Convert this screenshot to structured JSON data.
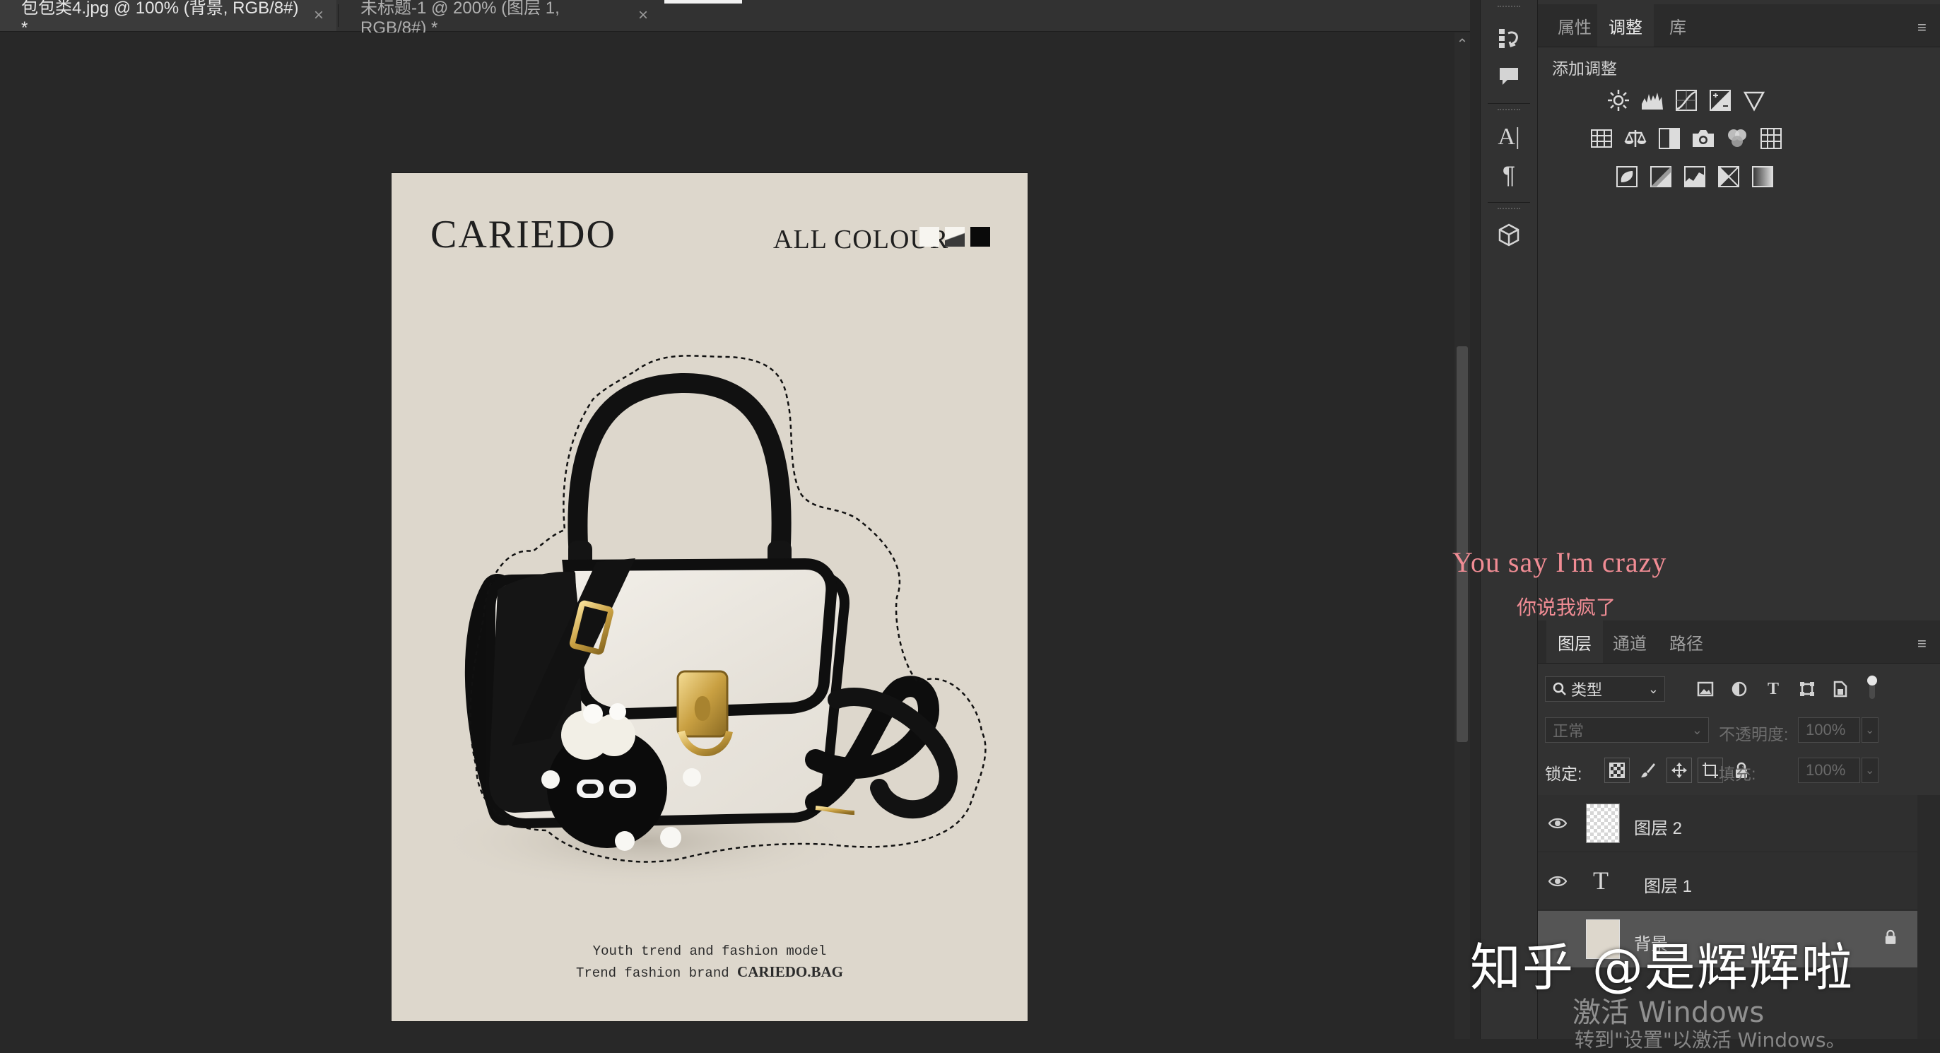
{
  "tabs": [
    {
      "label": "包包类4.jpg @ 100% (背景, RGB/8#) *",
      "close": "×"
    },
    {
      "label": "未标题-1 @ 200% (图层 1, RGB/8#) *",
      "close": "×"
    }
  ],
  "document": {
    "brand": "CARIEDO",
    "all_colour": "ALL COLOUR",
    "swatch_colors": [
      "#f7f5f0",
      "#3a3a3a",
      "#0a0a0a"
    ],
    "footer_line1": "Youth trend and fashion model",
    "footer_line2_prefix": "Trend fashion brand",
    "footer_line2_brand": "CARIEDO.BAG"
  },
  "panel_top": {
    "tabs": [
      "属性",
      "调整",
      "库"
    ],
    "active_tab": "调整",
    "add_adjustment_label": "添加调整"
  },
  "layers_panel": {
    "tabs": [
      "图层",
      "通道",
      "路径"
    ],
    "active_tab": "图层",
    "filter_kind": "类型",
    "blend_mode": "正常",
    "opacity_label": "不透明度:",
    "opacity_value": "100%",
    "lock_label": "锁定:",
    "fill_label": "填充:",
    "fill_value": "100%",
    "layers": [
      {
        "name": "图层 2",
        "type": "pixel",
        "visible": true
      },
      {
        "name": "图层 1",
        "type": "text",
        "visible": true
      },
      {
        "name": "背景",
        "type": "background",
        "visible": true
      }
    ]
  },
  "overlays": {
    "lyric_en": "You say I'm crazy",
    "lyric_zh": "你说我疯了",
    "watermark": "知乎 @是辉辉啦",
    "activate_title": "激活 Windows",
    "activate_sub": "转到\"设置\"以激活 Windows。"
  },
  "colors": {
    "app_bg": "#282828",
    "panel_bg": "#323232",
    "doc_bg": "#ddd7cc",
    "lyric": "#f08c94"
  }
}
